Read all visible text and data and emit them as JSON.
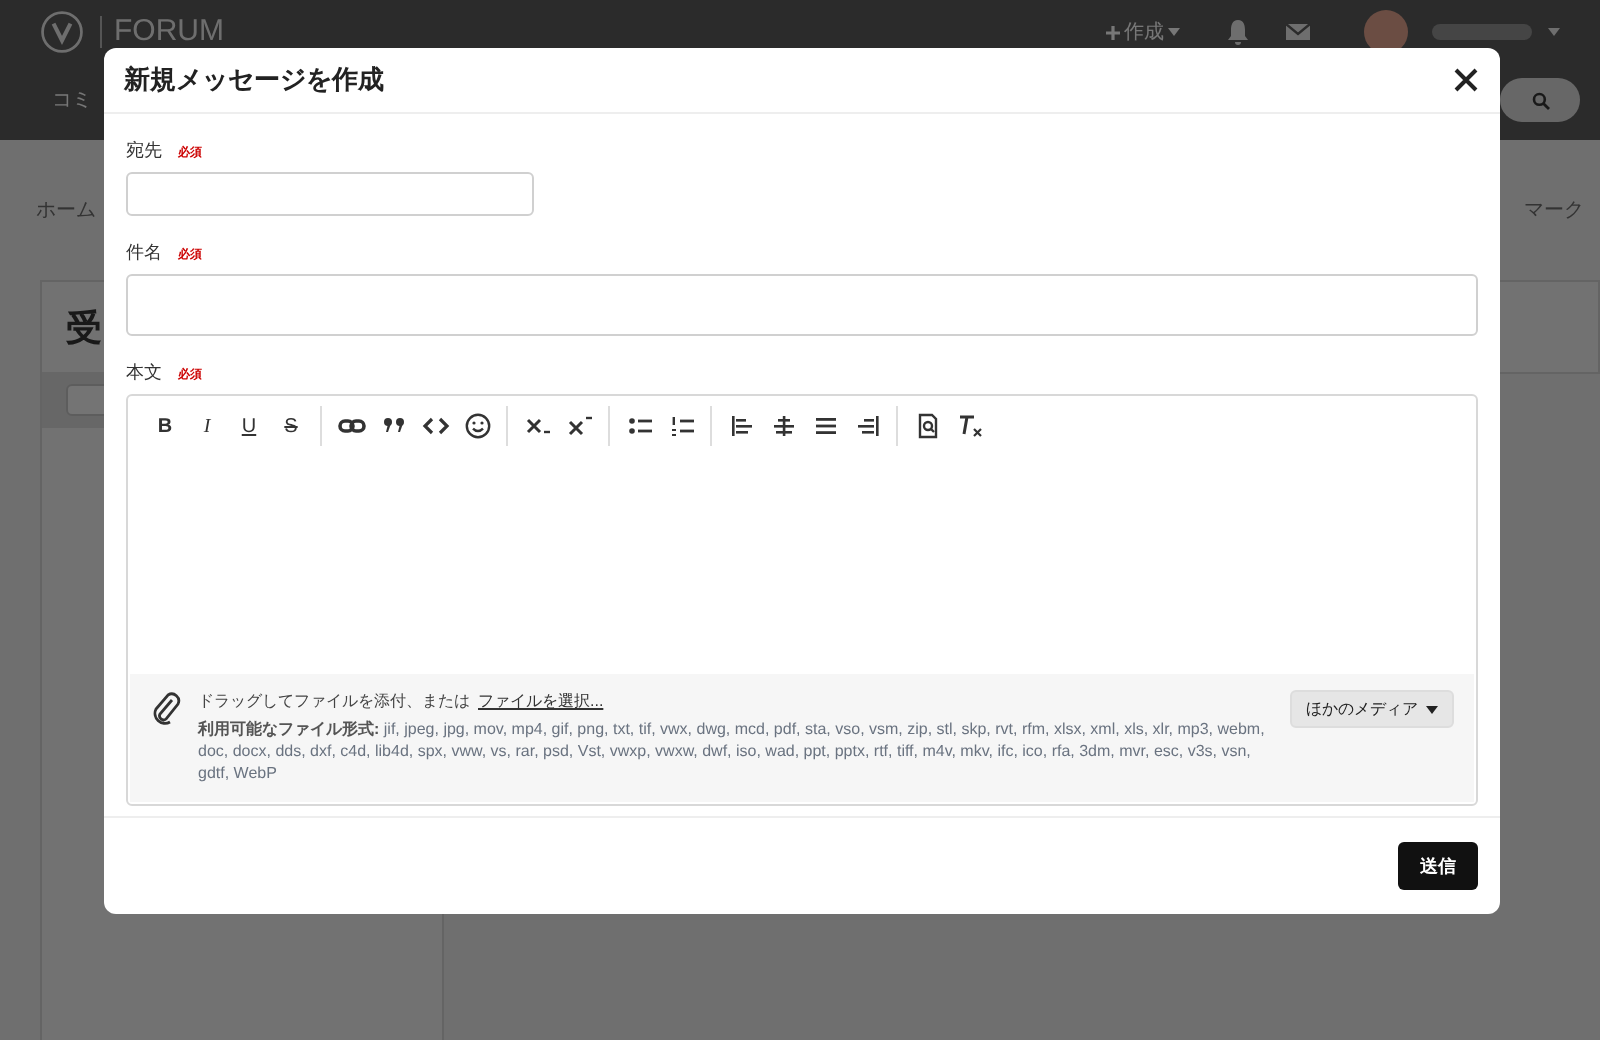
{
  "background": {
    "logo": "FORUM",
    "create_menu": "作成",
    "nav_item": "コミ",
    "breadcrumb": "ホーム",
    "mark_link": "マーク",
    "card_title": "受"
  },
  "dialog": {
    "title": "新規メッセージを作成",
    "fields": [
      {
        "label": "宛先",
        "required_badge": "必須",
        "kind": "short"
      },
      {
        "label": "件名",
        "required_badge": "必須",
        "kind": "wide"
      }
    ],
    "body": {
      "label": "本文",
      "required_badge": "必須",
      "format_buttons": [
        "B",
        "I",
        "U",
        "S"
      ],
      "drop_hint": "ドラッグしてファイルを添付、または",
      "browse_link": "ファイルを選択...",
      "formats": "**利用可能なファイル形式:** jif, jpeg, jpg, mov, mp4, gif, png, txt, tif, vwx, dwg, mcd, pdf, sta, vso, vsm, zip, stl, skp, rvt, rfm, xlsx, xml, xls, xlr, mp3, webm, doc, docx, dds, dxf, c4d, lib4d, spx, vww, vs, rar, psd, Vst, vwxp, vwxw, dwf, iso, wad, ppt, pptx, rtf, tiff, m4v, mkv, ifc, ico, rfa, 3dm, mvr, esc, v3s, vsn, gdtf, WebP",
      "media_button": "ほかのメディア"
    },
    "send_button": "送信"
  }
}
